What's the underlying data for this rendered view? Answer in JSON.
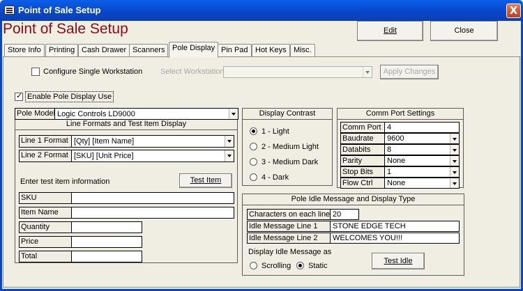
{
  "window": {
    "title": "Point of Sale Setup",
    "close_glyph": "X"
  },
  "header": {
    "form_title": "Point of Sale Setup",
    "edit_label": "Edit",
    "close_label": "Close"
  },
  "tabs": [
    {
      "label": "Store Info"
    },
    {
      "label": "Printing"
    },
    {
      "label": "Cash Drawer"
    },
    {
      "label": "Scanners"
    },
    {
      "label": "Pole Display",
      "active": true
    },
    {
      "label": "Pin Pad"
    },
    {
      "label": "Hot Keys"
    },
    {
      "label": "Misc."
    }
  ],
  "workstation": {
    "configure_single_label": "Configure Single Workstation",
    "configure_single_checked": false,
    "select_label": "Select Workstation",
    "select_value": "",
    "apply_label": "Apply Changes"
  },
  "enable_pole": {
    "label": "Enable Pole Display Use",
    "checked": true
  },
  "pole_model": {
    "label": "Pole Model",
    "value": "Logic Controls LD9000"
  },
  "line_formats": {
    "header": "Line Formats and Test Item Display",
    "line1_label": "Line 1 Format",
    "line1_value": "[Qty] [Item Name]",
    "line2_label": "Line 2 Format",
    "line2_value": "[SKU] [Unit Price]",
    "enter_test_label": "Enter test item information",
    "test_item_label": "Test Item",
    "fields": [
      {
        "label": "SKU",
        "value": ""
      },
      {
        "label": "Item Name",
        "value": ""
      },
      {
        "label": "Quantity",
        "value": ""
      },
      {
        "label": "Price",
        "value": ""
      },
      {
        "label": "Total",
        "value": ""
      }
    ]
  },
  "contrast": {
    "header": "Display Contrast",
    "options": [
      {
        "label": "1 - Light",
        "selected": true
      },
      {
        "label": "2 - Medium Light",
        "selected": false
      },
      {
        "label": "3 - Medium Dark",
        "selected": false
      },
      {
        "label": "4 - Dark",
        "selected": false
      }
    ]
  },
  "comm_port": {
    "header": "Comm Port Settings",
    "rows": [
      {
        "label": "Comm Port",
        "value": "4",
        "dropdown": false
      },
      {
        "label": "Baudrate",
        "value": "9600",
        "dropdown": true
      },
      {
        "label": "Databits",
        "value": "8",
        "dropdown": true
      },
      {
        "label": "Parity",
        "value": "None",
        "dropdown": true
      },
      {
        "label": "Stop Bits",
        "value": "1",
        "dropdown": true
      },
      {
        "label": "Flow Ctrl",
        "value": "None",
        "dropdown": true
      }
    ]
  },
  "idle": {
    "header": "Pole Idle Message and Display Type",
    "chars_label": "Characters on each line",
    "chars_value": "20",
    "line1_label": "Idle Message Line 1",
    "line1_value": "STONE EDGE TECH",
    "line2_label": "Idle Message Line 2",
    "line2_value": "WELCOMES YOU!!!",
    "display_as_label": "Display Idle Message as",
    "scrolling_label": "Scrolling",
    "scrolling_selected": false,
    "static_label": "Static",
    "static_selected": true,
    "test_idle_label": "Test Idle"
  }
}
